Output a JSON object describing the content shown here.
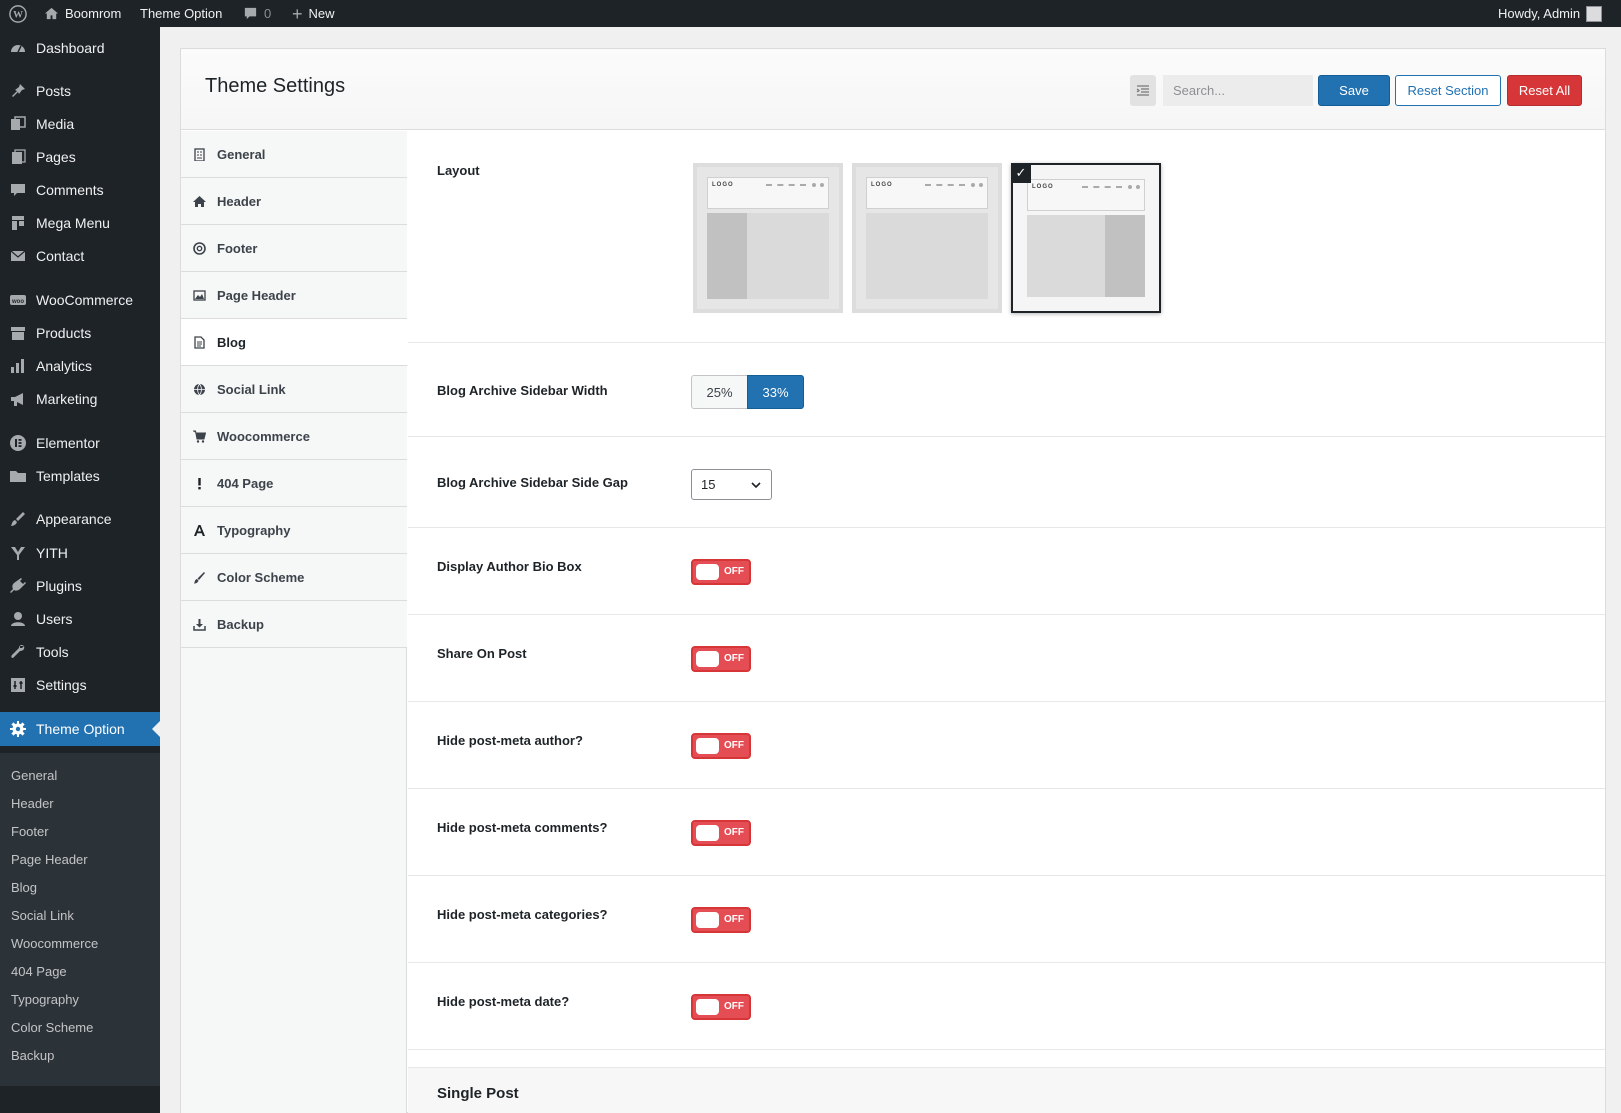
{
  "adminbar": {
    "site_name": "Boomrom",
    "theme_option": "Theme Option",
    "comments_count": "0",
    "new_label": "New",
    "howdy": "Howdy, Admin"
  },
  "menu": {
    "items": [
      {
        "label": "Dashboard",
        "icon": "dashboard-icon"
      },
      {
        "label": "Posts",
        "icon": "pin-icon"
      },
      {
        "label": "Media",
        "icon": "media-icon"
      },
      {
        "label": "Pages",
        "icon": "pages-icon"
      },
      {
        "label": "Comments",
        "icon": "comment-icon"
      },
      {
        "label": "Mega Menu",
        "icon": "mega-menu-icon"
      },
      {
        "label": "Contact",
        "icon": "mail-icon"
      },
      {
        "label": "WooCommerce",
        "icon": "woo-icon"
      },
      {
        "label": "Products",
        "icon": "archive-icon"
      },
      {
        "label": "Analytics",
        "icon": "bar-chart-icon"
      },
      {
        "label": "Marketing",
        "icon": "megaphone-icon"
      },
      {
        "label": "Elementor",
        "icon": "elementor-icon"
      },
      {
        "label": "Templates",
        "icon": "folder-icon"
      },
      {
        "label": "Appearance",
        "icon": "brush-icon"
      },
      {
        "label": "YITH",
        "icon": "yith-icon"
      },
      {
        "label": "Plugins",
        "icon": "plug-icon"
      },
      {
        "label": "Users",
        "icon": "user-icon"
      },
      {
        "label": "Tools",
        "icon": "wrench-icon"
      },
      {
        "label": "Settings",
        "icon": "settings-icon"
      },
      {
        "label": "Theme Option",
        "icon": "gear-icon"
      }
    ],
    "submenu": [
      "General",
      "Header",
      "Footer",
      "Page Header",
      "Blog",
      "Social Link",
      "Woocommerce",
      "404 Page",
      "Typography",
      "Color Scheme",
      "Backup"
    ]
  },
  "panel": {
    "title": "Theme Settings",
    "search_placeholder": "Search...",
    "save": "Save",
    "reset_section": "Reset Section",
    "reset_all": "Reset All"
  },
  "sections": [
    {
      "label": "General",
      "icon": "building-icon"
    },
    {
      "label": "Header",
      "icon": "home-icon"
    },
    {
      "label": "Footer",
      "icon": "lifebuoy-icon"
    },
    {
      "label": "Page Header",
      "icon": "image-icon"
    },
    {
      "label": "Blog",
      "icon": "document-icon",
      "active": true
    },
    {
      "label": "Social Link",
      "icon": "globe-icon"
    },
    {
      "label": "Woocommerce",
      "icon": "cart-icon"
    },
    {
      "label": "404 Page",
      "icon": "exclamation-icon"
    },
    {
      "label": "Typography",
      "icon": "font-icon"
    },
    {
      "label": "Color Scheme",
      "icon": "paintbrush-icon"
    },
    {
      "label": "Backup",
      "icon": "download-icon"
    }
  ],
  "fields": {
    "layout": {
      "label": "Layout",
      "logo_text": "LOGO",
      "selected": "right-sidebar"
    },
    "sidebar_width": {
      "label": "Blog Archive Sidebar Width",
      "options": [
        "25%",
        "33%"
      ],
      "selected": "33%"
    },
    "side_gap": {
      "label": "Blog Archive Sidebar Side Gap",
      "value": "15"
    },
    "toggles": [
      {
        "label": "Display Author Bio Box",
        "state": "OFF"
      },
      {
        "label": "Share On Post",
        "state": "OFF"
      },
      {
        "label": "Hide post-meta author?",
        "state": "OFF"
      },
      {
        "label": "Hide post-meta comments?",
        "state": "OFF"
      },
      {
        "label": "Hide post-meta categories?",
        "state": "OFF"
      },
      {
        "label": "Hide post-meta date?",
        "state": "OFF"
      }
    ],
    "single_post_heading": "Single Post"
  },
  "colors": {
    "primary": "#2271b1",
    "danger": "#d63638",
    "toggle_off": "#e54d54",
    "admin_dark": "#1d2327"
  }
}
